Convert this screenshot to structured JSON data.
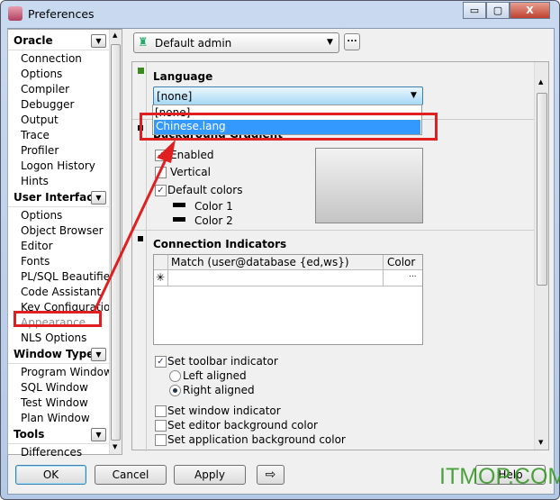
{
  "window": {
    "title": "Preferences",
    "minimize": "▭",
    "maximize": "▢",
    "close": "X"
  },
  "sidebar": {
    "sections": [
      {
        "header": "Oracle",
        "items": [
          "Connection",
          "Options",
          "Compiler",
          "Debugger",
          "Output",
          "Trace",
          "Profiler",
          "Logon History",
          "Hints"
        ]
      },
      {
        "header": "User Interface",
        "items": [
          "Options",
          "Object Browser",
          "Editor",
          "Fonts",
          "PL/SQL Beautifier",
          "Code Assistant",
          "Key Configuration",
          "Appearance",
          "NLS Options"
        ]
      },
      {
        "header": "Window Types",
        "items": [
          "Program Window",
          "SQL Window",
          "Test Window",
          "Plan Window"
        ]
      },
      {
        "header": "Tools",
        "items": [
          "Differences"
        ]
      }
    ],
    "selected": "Appearance"
  },
  "profile": {
    "value": "Default admin",
    "more": "..."
  },
  "language": {
    "title": "Language",
    "value": "[none]",
    "options": [
      "[none]",
      "Chinese.lang"
    ],
    "highlighted": "Chinese.lang"
  },
  "gradient": {
    "title": "Background Gradient",
    "enabled": {
      "label": "Enabled",
      "checked": true
    },
    "vertical": {
      "label": "Vertical",
      "checked": false
    },
    "default_colors": {
      "label": "Default colors",
      "checked": true
    },
    "color1": "Color 1",
    "color2": "Color 2"
  },
  "connection": {
    "title": "Connection Indicators",
    "columns": [
      "Match (user@database {ed,ws})",
      "Color"
    ],
    "new_row_marker": "✳",
    "cell_more": "...",
    "toolbar_indicator": {
      "label": "Set toolbar indicator",
      "checked": true
    },
    "left_aligned": {
      "label": "Left aligned",
      "selected": false
    },
    "right_aligned": {
      "label": "Right aligned",
      "selected": true
    },
    "window_indicator": {
      "label": "Set window indicator",
      "checked": false
    },
    "editor_bg": {
      "label": "Set editor background color",
      "checked": false
    },
    "app_bg": {
      "label": "Set application background color",
      "checked": false
    }
  },
  "buttons": {
    "ok": "OK",
    "cancel": "Cancel",
    "apply": "Apply",
    "help": "Help"
  },
  "watermark": "ITMOP.COM",
  "colors": {
    "highlight": "#3399ff",
    "annotation": "#e02020",
    "watermark": "#3a9a2a"
  }
}
